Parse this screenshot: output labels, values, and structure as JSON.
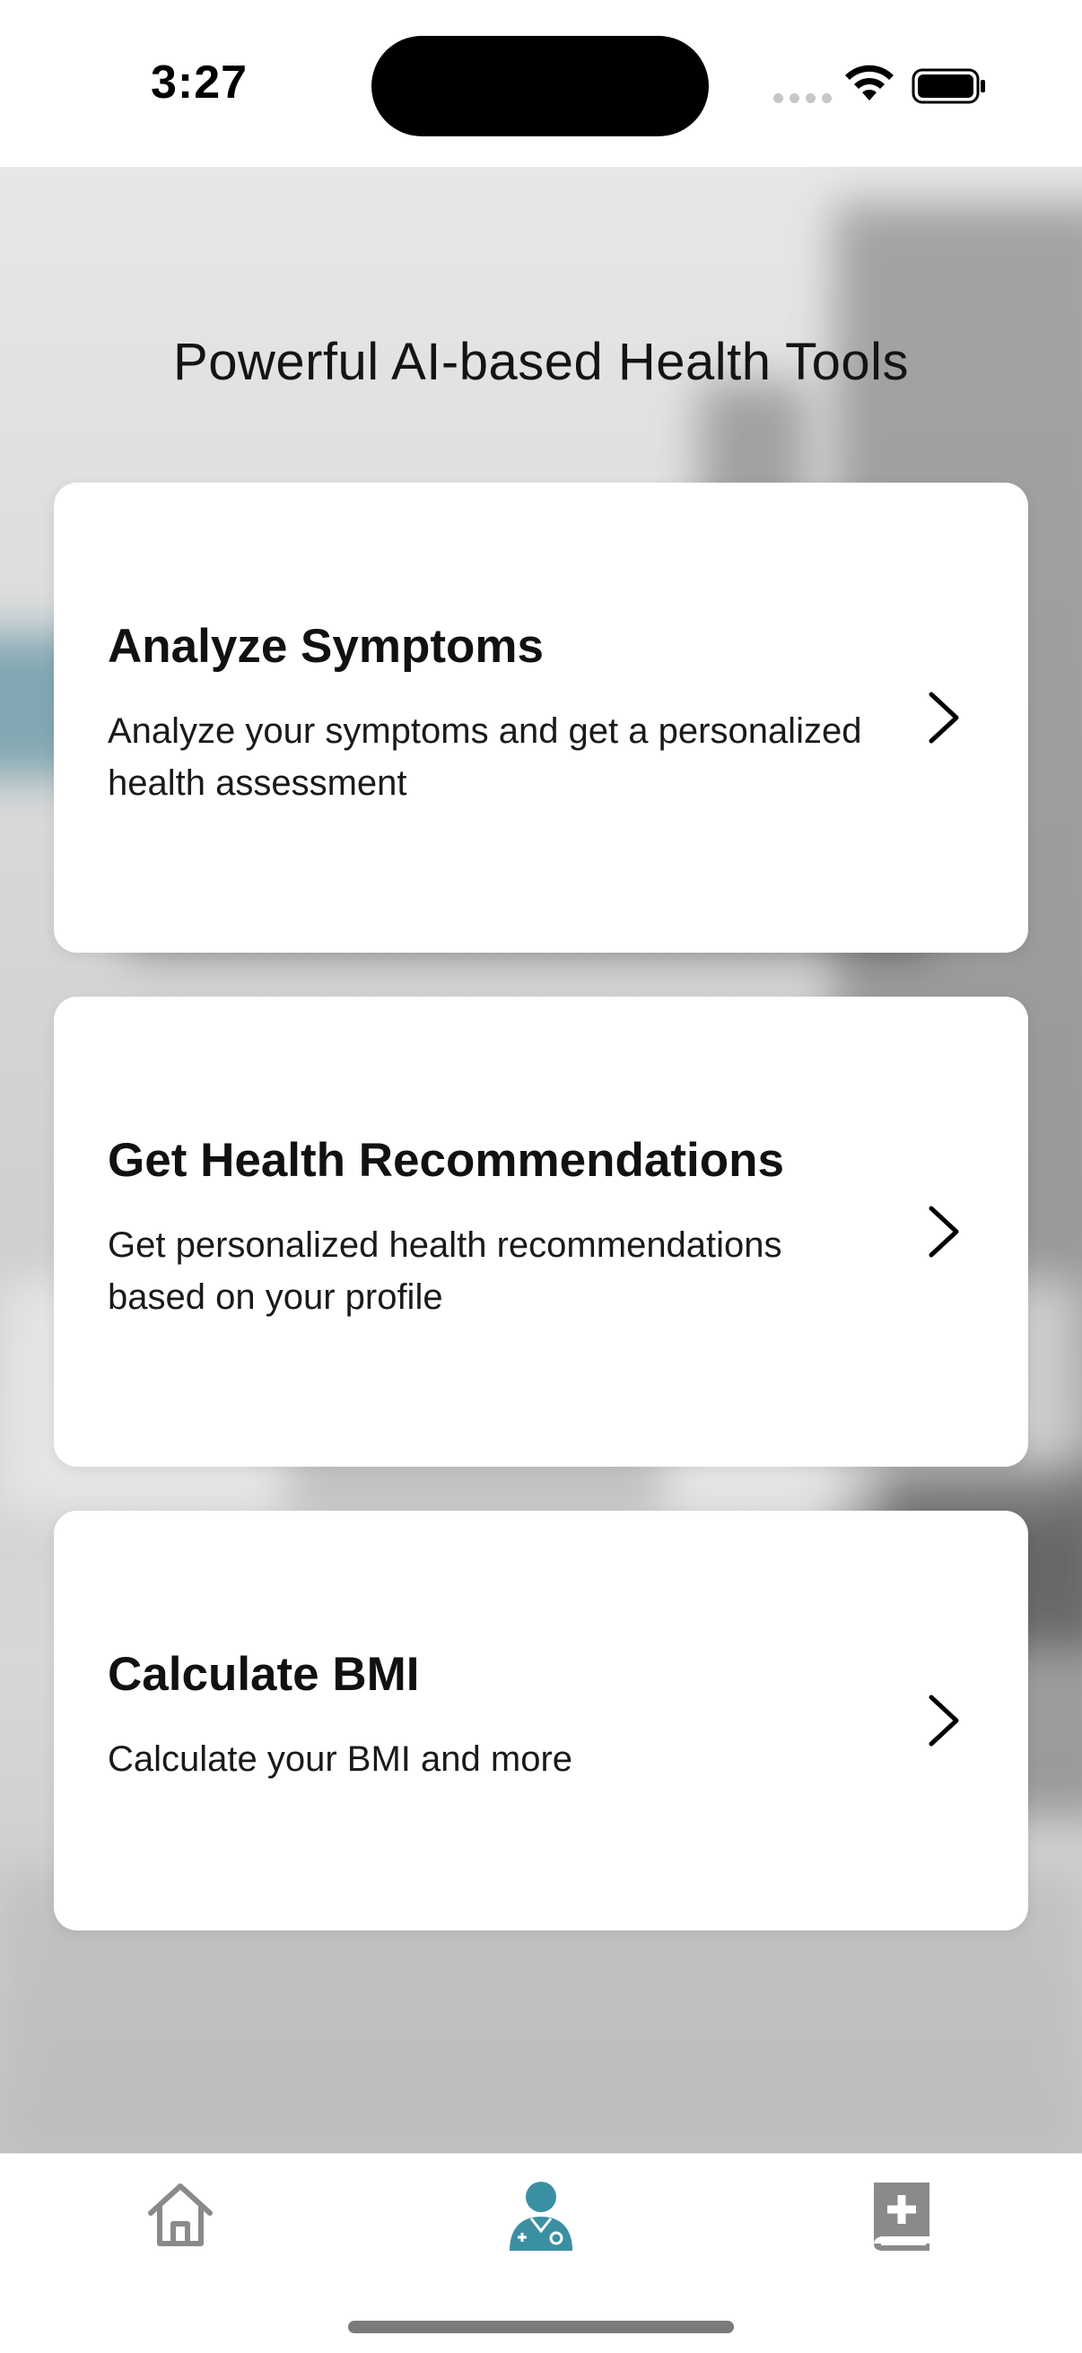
{
  "status_bar": {
    "time": "3:27"
  },
  "page": {
    "title": "Powerful AI-based Health Tools"
  },
  "cards": [
    {
      "title": "Analyze Symptoms",
      "description": "Analyze your symptoms and get a personalized health assessment",
      "icon": "chevron-right-icon"
    },
    {
      "title": "Get Health Recommendations",
      "description": "Get personalized health recommendations based on your profile",
      "icon": "chevron-right-icon"
    },
    {
      "title": "Calculate BMI",
      "description": "Calculate your BMI and more",
      "icon": "chevron-right-icon"
    }
  ],
  "tab_bar": {
    "tabs": [
      {
        "icon": "home-icon",
        "active": false
      },
      {
        "icon": "doctor-icon",
        "active": true
      },
      {
        "icon": "medical-book-icon",
        "active": false
      }
    ],
    "active_color": "#3a8fa3",
    "inactive_color": "#8a8a8a"
  }
}
